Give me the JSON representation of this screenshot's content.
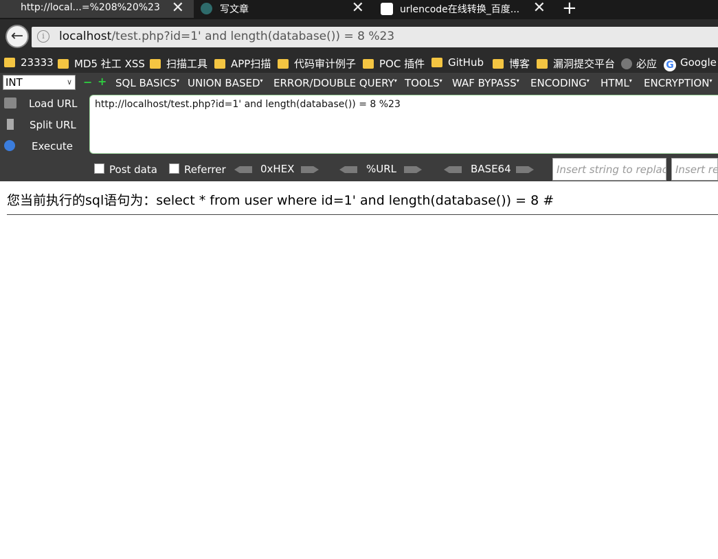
{
  "tabs": [
    {
      "title": "http://local...=%208%20%23",
      "close": "✕"
    },
    {
      "title": "写文章",
      "close": "✕"
    },
    {
      "title": "urlencode在线转换_百度...",
      "close": "✕"
    }
  ],
  "new_tab": "+",
  "address": {
    "host": "localhost",
    "path": "/test.php?id=1' and length(database()) = 8 %23",
    "info": "i"
  },
  "bookmarks": [
    "23333",
    "MD5 社工 XSS",
    "扫描工具",
    "APP扫描",
    "代码审计例子",
    "POC 插件",
    "GitHub",
    "博客",
    "漏洞提交平台",
    "必应",
    "Google"
  ],
  "hackbar": {
    "select_value": "INT",
    "minus": "−",
    "plus": "+",
    "menus": [
      "SQL BASICS",
      "UNION BASED",
      "ERROR/DOUBLE QUERY",
      "TOOLS",
      "WAF BYPASS",
      "ENCODING",
      "HTML",
      "ENCRYPTION"
    ],
    "load_url": "Load URL",
    "split_url": "Split URL",
    "execute": "Execute",
    "url_value": "http://localhost/test.php?id=1' and length(database()) = 8 %23",
    "post_data": "Post data",
    "referrer": "Referrer",
    "encoders": [
      "0xHEX",
      "%URL",
      "BASE64"
    ],
    "replace_placeholder": "Insert string to replace",
    "replace_with_placeholder": "Insert replacing string"
  },
  "page": {
    "sql_line": "您当前执行的sql语句为：select * from user where id=1' and length(database()) = 8 #"
  },
  "colors": {
    "tab_active": "#3a3a3a",
    "toolbar": "#2b2b2b",
    "hackbar": "#3c3c3c",
    "folder": "#f4c542",
    "accent_green": "#2ecc40"
  }
}
